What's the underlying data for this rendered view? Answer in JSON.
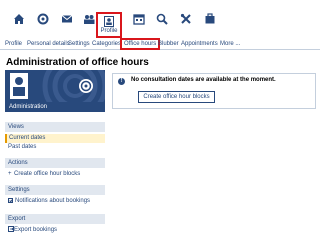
{
  "topbar": {
    "icons": [
      "home-icon",
      "activity-icon",
      "mail-icon",
      "community-icon",
      "profile-icon",
      "calendar-icon",
      "search-icon",
      "tools-icon",
      "admin-icon"
    ],
    "active_label": "Profile"
  },
  "tabs": [
    "Profile",
    "Personal details",
    "Settings",
    "Categories",
    "Office hours",
    "Blubber",
    "Appointments",
    "More ..."
  ],
  "page": {
    "title": "Administration of office hours",
    "admin_label": "Administration"
  },
  "sidebar": {
    "views": {
      "title": "Views",
      "items": [
        "Current dates",
        "Past dates"
      ]
    },
    "actions": {
      "title": "Actions",
      "items": [
        "Create office hour blocks"
      ]
    },
    "settings": {
      "title": "Settings",
      "items": [
        "Notifications about bookings"
      ]
    },
    "export": {
      "title": "Export",
      "items": [
        "Export bookings"
      ]
    }
  },
  "message": {
    "text": "No consultation dates are available at the moment.",
    "button": "Create office hour blocks"
  },
  "colors": {
    "brand": "#28497c",
    "highlight": "#d9161c",
    "current": "#fff3cd"
  }
}
